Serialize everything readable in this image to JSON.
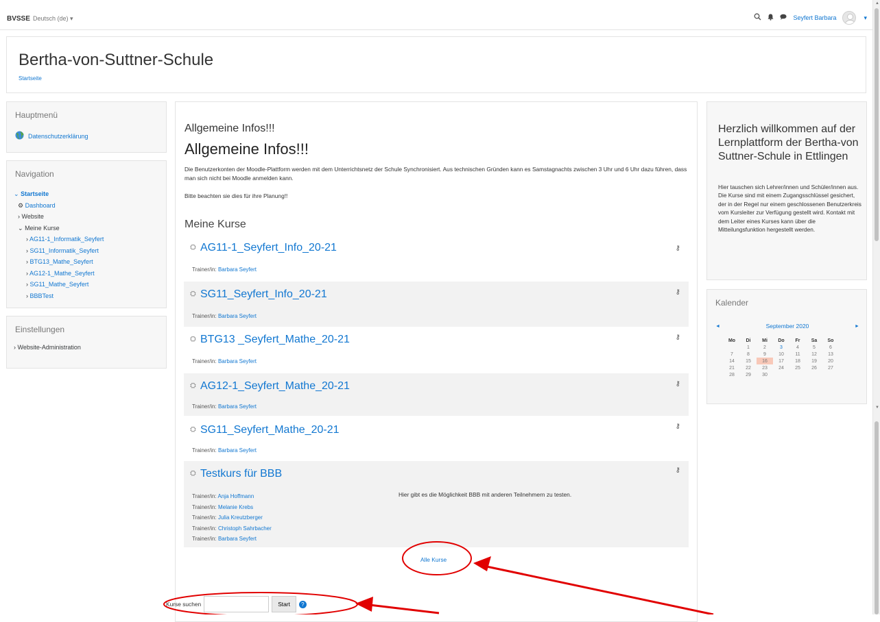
{
  "navbar": {
    "brand": "BVSSE",
    "language": "Deutsch (de)",
    "user_name": "Seyfert Barbara"
  },
  "header": {
    "site_title": "Bertha-von-Suttner-Schule",
    "breadcrumb": "Startseite"
  },
  "left": {
    "main_menu": {
      "title": "Hauptmenü",
      "items": [
        "Datenschutzerklärung"
      ]
    },
    "navigation": {
      "title": "Navigation",
      "home": "Startseite",
      "dashboard": "Dashboard",
      "website": "Website",
      "my_courses": "Meine Kurse",
      "courses": [
        "AG11-1_Informatik_Seyfert",
        "SG11_Informatik_Seyfert",
        "BTG13_Mathe_Seyfert",
        "AG12-1_Mathe_Seyfert",
        "SG11_Mathe_Seyfert",
        "BBBTest"
      ]
    },
    "settings": {
      "title": "Einstellungen",
      "items": [
        "Website-Administration"
      ]
    }
  },
  "main": {
    "section_title": "Allgemeine Infos!!!",
    "heading": "Allgemeine Infos!!!",
    "paragraph1": "Die Benutzerkonten der Moodle-Plattform werden mit dem Unterrichtsnetz der Schule Synchronisiert. Aus technischen Gründen kann es Samstagnachts zwischen 3 Uhr und 6 Uhr dazu führen, dass man sich nicht bei Moodle anmelden kann.",
    "paragraph2": "Bitte beachten sie dies für ihre Planung!!",
    "my_courses_title": "Meine Kurse",
    "trainer_label": "Trainer/in:",
    "courses": [
      {
        "name": "AG11-1_Seyfert_Info_20-21",
        "trainers": [
          "Barbara Seyfert"
        ]
      },
      {
        "name": "SG11_Seyfert_Info_20-21",
        "trainers": [
          "Barbara Seyfert"
        ]
      },
      {
        "name": "BTG13 _Seyfert_Mathe_20-21",
        "trainers": [
          "Barbara Seyfert"
        ]
      },
      {
        "name": "AG12-1_Seyfert_Mathe_20-21",
        "trainers": [
          "Barbara Seyfert"
        ]
      },
      {
        "name": "SG11_Seyfert_Mathe_20-21",
        "trainers": [
          "Barbara Seyfert"
        ]
      },
      {
        "name": "Testkurs für BBB",
        "trainers": [
          "Anja Hoffmann",
          "Melanie Krebs",
          "Julia Kreutzberger",
          "Christoph Sahrbacher",
          "Barbara Seyfert"
        ],
        "summary": "Hier gibt es die Möglichkeit BBB mit anderen Teilnehmern zu testen."
      }
    ],
    "all_courses": "Alle Kurse",
    "search_label": "Kurse suchen",
    "search_value": "",
    "search_button": "Start"
  },
  "right": {
    "welcome": {
      "title": "Herzlich willkommen auf der Lernplattform der Bertha-von Suttner-Schule in Ettlingen",
      "text": "Hier tauschen sich Lehrer/innen und Schüler/innen aus. Die Kurse sind mit einem Zugangsschlüssel gesichert, der in der Regel nur einem geschlossenen Benutzerkreis vom Kursleiter zur Verfügung gestellt wird. Kontakt mit dem Leiter eines Kurses kann über die Mitteilungsfunktion hergestellt werden."
    },
    "calendar": {
      "title": "Kalender",
      "month": "September 2020",
      "prev": "◄",
      "next": "►",
      "weekdays": [
        "Mo",
        "Di",
        "Mi",
        "Do",
        "Fr",
        "Sa",
        "So"
      ],
      "weeks": [
        [
          "",
          "1",
          "2",
          "3",
          "4",
          "5",
          "6"
        ],
        [
          "7",
          "8",
          "9",
          "10",
          "11",
          "12",
          "13"
        ],
        [
          "14",
          "15",
          "16",
          "17",
          "18",
          "19",
          "20"
        ],
        [
          "21",
          "22",
          "23",
          "24",
          "25",
          "26",
          "27"
        ],
        [
          "28",
          "29",
          "30",
          "",
          "",
          "",
          ""
        ]
      ],
      "today": "16",
      "event_day": "3"
    }
  },
  "colors": {
    "link": "#1177d1",
    "annotation": "#e10000",
    "today_bg": "#f8c8b8"
  }
}
